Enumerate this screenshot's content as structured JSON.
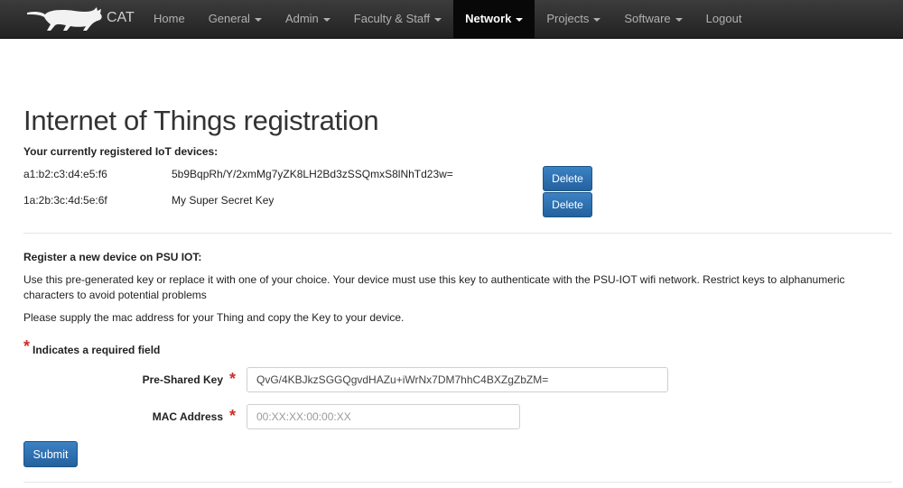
{
  "navbar": {
    "brand": "CAT",
    "items": [
      {
        "label": "Home",
        "dropdown": false,
        "active": false
      },
      {
        "label": "General",
        "dropdown": true,
        "active": false
      },
      {
        "label": "Admin",
        "dropdown": true,
        "active": false
      },
      {
        "label": "Faculty & Staff",
        "dropdown": true,
        "active": false
      },
      {
        "label": "Network",
        "dropdown": true,
        "active": true
      },
      {
        "label": "Projects",
        "dropdown": true,
        "active": false
      },
      {
        "label": "Software",
        "dropdown": true,
        "active": false
      },
      {
        "label": "Logout",
        "dropdown": false,
        "active": false
      }
    ]
  },
  "page": {
    "title": "Internet of Things registration",
    "registered_heading": "Your currently registered IoT devices:",
    "devices": [
      {
        "mac": "a1:b2:c3:d4:e5:f6",
        "key": "5b9BqpRh/Y/2xmMg7yZK8LH2Bd3zSSQmxS8lNhTd23w=",
        "delete_label": "Delete"
      },
      {
        "mac": "1a:2b:3c:4d:5e:6f",
        "key": "My Super Secret Key",
        "delete_label": "Delete"
      }
    ],
    "register_heading": "Register a new device on PSU IOT:",
    "info_text": "Use this pre-generated key or replace it with one of your choice. Your device must use this key to authenticate with the PSU-IOT wifi network. Restrict keys to alphanumeric characters to avoid potential problems",
    "supply_text": "Please supply the mac address for your Thing and copy the Key to your device.",
    "required_star": "*",
    "required_text": "Indicates a required field",
    "form": {
      "psk_label": "Pre-Shared Key",
      "psk_value": "QvG/4KBJkzSGGQgvdHAZu+iWrNx7DM7hhC4BXZgZbZM=",
      "mac_label": "MAC Address",
      "mac_placeholder": "00:XX:XX:00:00:XX",
      "mac_value": "",
      "submit_label": "Submit"
    }
  },
  "colors": {
    "navbar": "#222222",
    "active_nav": "#080808",
    "button": "#2f73b3",
    "required": "#c9302c"
  }
}
